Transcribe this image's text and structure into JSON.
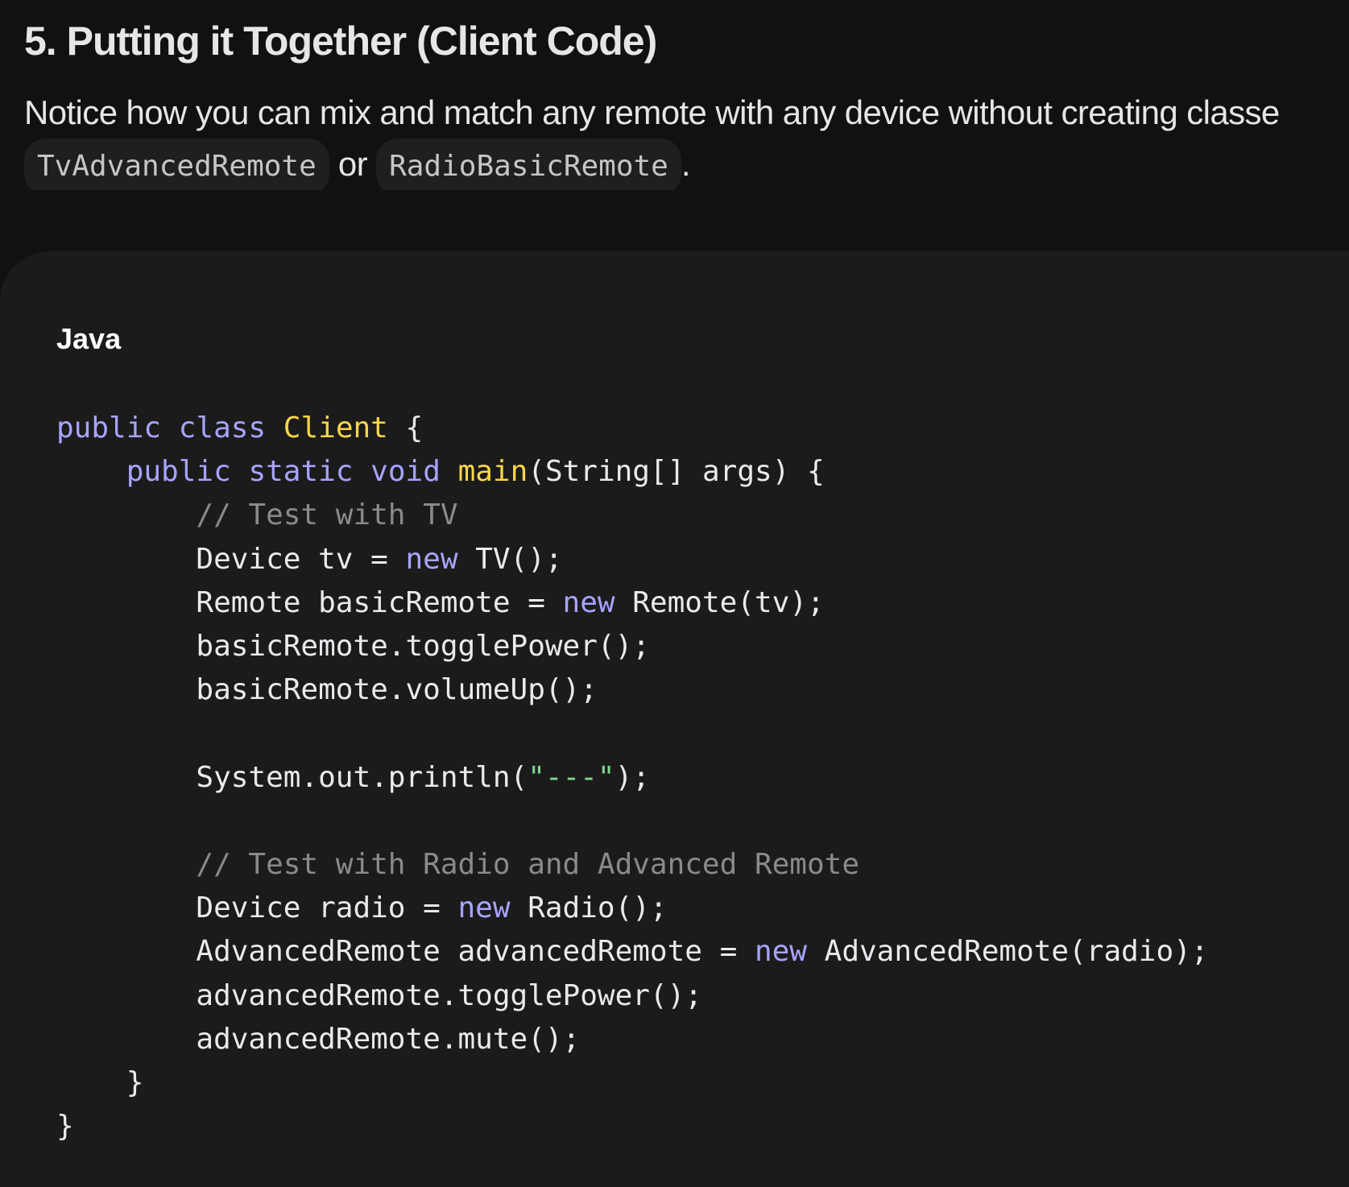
{
  "section": {
    "heading": "5. Putting it Together (Client Code)",
    "para_start": "Notice how you can mix and match any remote with any device without creating classe",
    "code_1": "TvAdvancedRemote",
    "joiner": " or ",
    "code_2": "RadioBasicRemote",
    "para_end": "."
  },
  "code_block": {
    "language": "Java",
    "tokens": {
      "public": "public",
      "class": "class",
      "static": "static",
      "void": "void",
      "new": "new",
      "client": "Client",
      "main": "main",
      "brace_open": " {",
      "brace_close": "}",
      "main_params": "(String[] args) {",
      "comment_1": "// Test with TV",
      "comment_2": "// Test with Radio and Advanced Remote",
      "device_tv": "Device tv = ",
      "tv_ctor": " TV();",
      "remote_basic": "Remote basicRemote = ",
      "remote_ctor": " Remote(tv);",
      "basic_toggle": "basicRemote.togglePower();",
      "basic_volume": "basicRemote.volumeUp();",
      "println_start": "System.out.println(",
      "println_str": "\"---\"",
      "println_end": ");",
      "device_radio": "Device radio = ",
      "radio_ctor": " Radio();",
      "advanced_decl": "AdvancedRemote advancedRemote = ",
      "advanced_ctor": " AdvancedRemote(radio);",
      "advanced_toggle": "advancedRemote.togglePower();",
      "advanced_mute": "advancedRemote.mute();"
    }
  }
}
